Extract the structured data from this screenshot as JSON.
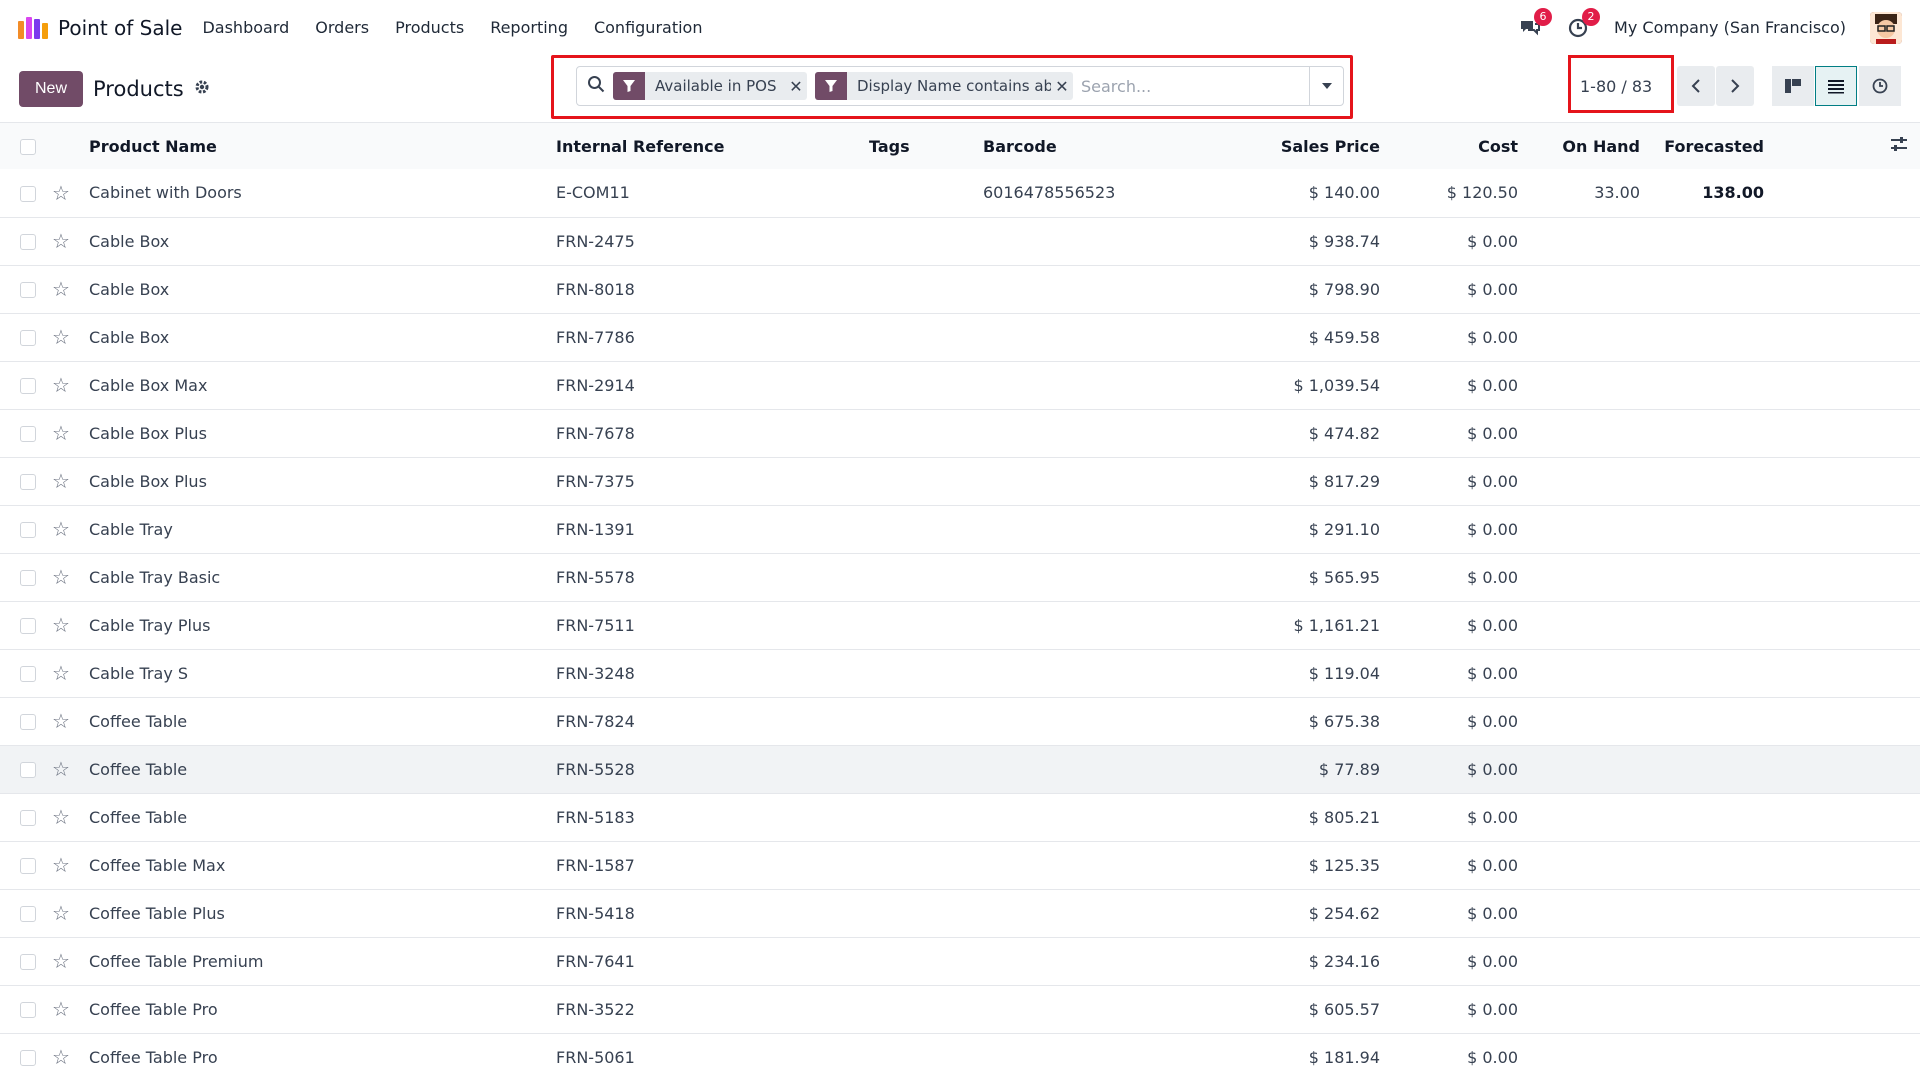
{
  "app": {
    "title": "Point of Sale",
    "brand_colors": [
      "#f28c28",
      "#d946ef",
      "#7c3aed"
    ]
  },
  "menu": {
    "items": [
      {
        "label": "Dashboard"
      },
      {
        "label": "Orders"
      },
      {
        "label": "Products"
      },
      {
        "label": "Reporting"
      },
      {
        "label": "Configuration"
      }
    ]
  },
  "systray": {
    "messages_count": "6",
    "activities_count": "2",
    "company": "My Company (San Francisco)"
  },
  "control": {
    "new_label": "New",
    "title": "Products",
    "search": {
      "facets": [
        {
          "label": "Available in POS"
        },
        {
          "label": "Display Name contains ab"
        }
      ],
      "placeholder": "Search..."
    },
    "pager": "1-80 / 83"
  },
  "table": {
    "headers": {
      "name": "Product Name",
      "ref": "Internal Reference",
      "tags": "Tags",
      "barcode": "Barcode",
      "price": "Sales Price",
      "cost": "Cost",
      "onhand": "On Hand",
      "forecast": "Forecasted"
    },
    "rows": [
      {
        "name": "Cabinet with Doors",
        "ref": "E-COM11",
        "barcode": "6016478556523",
        "price": "$ 140.00",
        "cost": "$ 120.50",
        "onhand": "33.00",
        "forecast": "138.00"
      },
      {
        "name": "Cable Box",
        "ref": "FRN-2475",
        "barcode": "",
        "price": "$ 938.74",
        "cost": "$ 0.00",
        "onhand": "",
        "forecast": ""
      },
      {
        "name": "Cable Box",
        "ref": "FRN-8018",
        "barcode": "",
        "price": "$ 798.90",
        "cost": "$ 0.00",
        "onhand": "",
        "forecast": ""
      },
      {
        "name": "Cable Box",
        "ref": "FRN-7786",
        "barcode": "",
        "price": "$ 459.58",
        "cost": "$ 0.00",
        "onhand": "",
        "forecast": ""
      },
      {
        "name": "Cable Box Max",
        "ref": "FRN-2914",
        "barcode": "",
        "price": "$ 1,039.54",
        "cost": "$ 0.00",
        "onhand": "",
        "forecast": ""
      },
      {
        "name": "Cable Box Plus",
        "ref": "FRN-7678",
        "barcode": "",
        "price": "$ 474.82",
        "cost": "$ 0.00",
        "onhand": "",
        "forecast": ""
      },
      {
        "name": "Cable Box Plus",
        "ref": "FRN-7375",
        "barcode": "",
        "price": "$ 817.29",
        "cost": "$ 0.00",
        "onhand": "",
        "forecast": ""
      },
      {
        "name": "Cable Tray",
        "ref": "FRN-1391",
        "barcode": "",
        "price": "$ 291.10",
        "cost": "$ 0.00",
        "onhand": "",
        "forecast": ""
      },
      {
        "name": "Cable Tray Basic",
        "ref": "FRN-5578",
        "barcode": "",
        "price": "$ 565.95",
        "cost": "$ 0.00",
        "onhand": "",
        "forecast": ""
      },
      {
        "name": "Cable Tray Plus",
        "ref": "FRN-7511",
        "barcode": "",
        "price": "$ 1,161.21",
        "cost": "$ 0.00",
        "onhand": "",
        "forecast": ""
      },
      {
        "name": "Cable Tray S",
        "ref": "FRN-3248",
        "barcode": "",
        "price": "$ 119.04",
        "cost": "$ 0.00",
        "onhand": "",
        "forecast": ""
      },
      {
        "name": "Coffee Table",
        "ref": "FRN-7824",
        "barcode": "",
        "price": "$ 675.38",
        "cost": "$ 0.00",
        "onhand": "",
        "forecast": ""
      },
      {
        "name": "Coffee Table",
        "ref": "FRN-5528",
        "barcode": "",
        "price": "$ 77.89",
        "cost": "$ 0.00",
        "onhand": "",
        "forecast": ""
      },
      {
        "name": "Coffee Table",
        "ref": "FRN-5183",
        "barcode": "",
        "price": "$ 805.21",
        "cost": "$ 0.00",
        "onhand": "",
        "forecast": ""
      },
      {
        "name": "Coffee Table Max",
        "ref": "FRN-1587",
        "barcode": "",
        "price": "$ 125.35",
        "cost": "$ 0.00",
        "onhand": "",
        "forecast": ""
      },
      {
        "name": "Coffee Table Plus",
        "ref": "FRN-5418",
        "barcode": "",
        "price": "$ 254.62",
        "cost": "$ 0.00",
        "onhand": "",
        "forecast": ""
      },
      {
        "name": "Coffee Table Premium",
        "ref": "FRN-7641",
        "barcode": "",
        "price": "$ 234.16",
        "cost": "$ 0.00",
        "onhand": "",
        "forecast": ""
      },
      {
        "name": "Coffee Table Pro",
        "ref": "FRN-3522",
        "barcode": "",
        "price": "$ 605.57",
        "cost": "$ 0.00",
        "onhand": "",
        "forecast": ""
      },
      {
        "name": "Coffee Table Pro",
        "ref": "FRN-5061",
        "barcode": "",
        "price": "$ 181.94",
        "cost": "$ 0.00",
        "onhand": "",
        "forecast": ""
      }
    ]
  }
}
